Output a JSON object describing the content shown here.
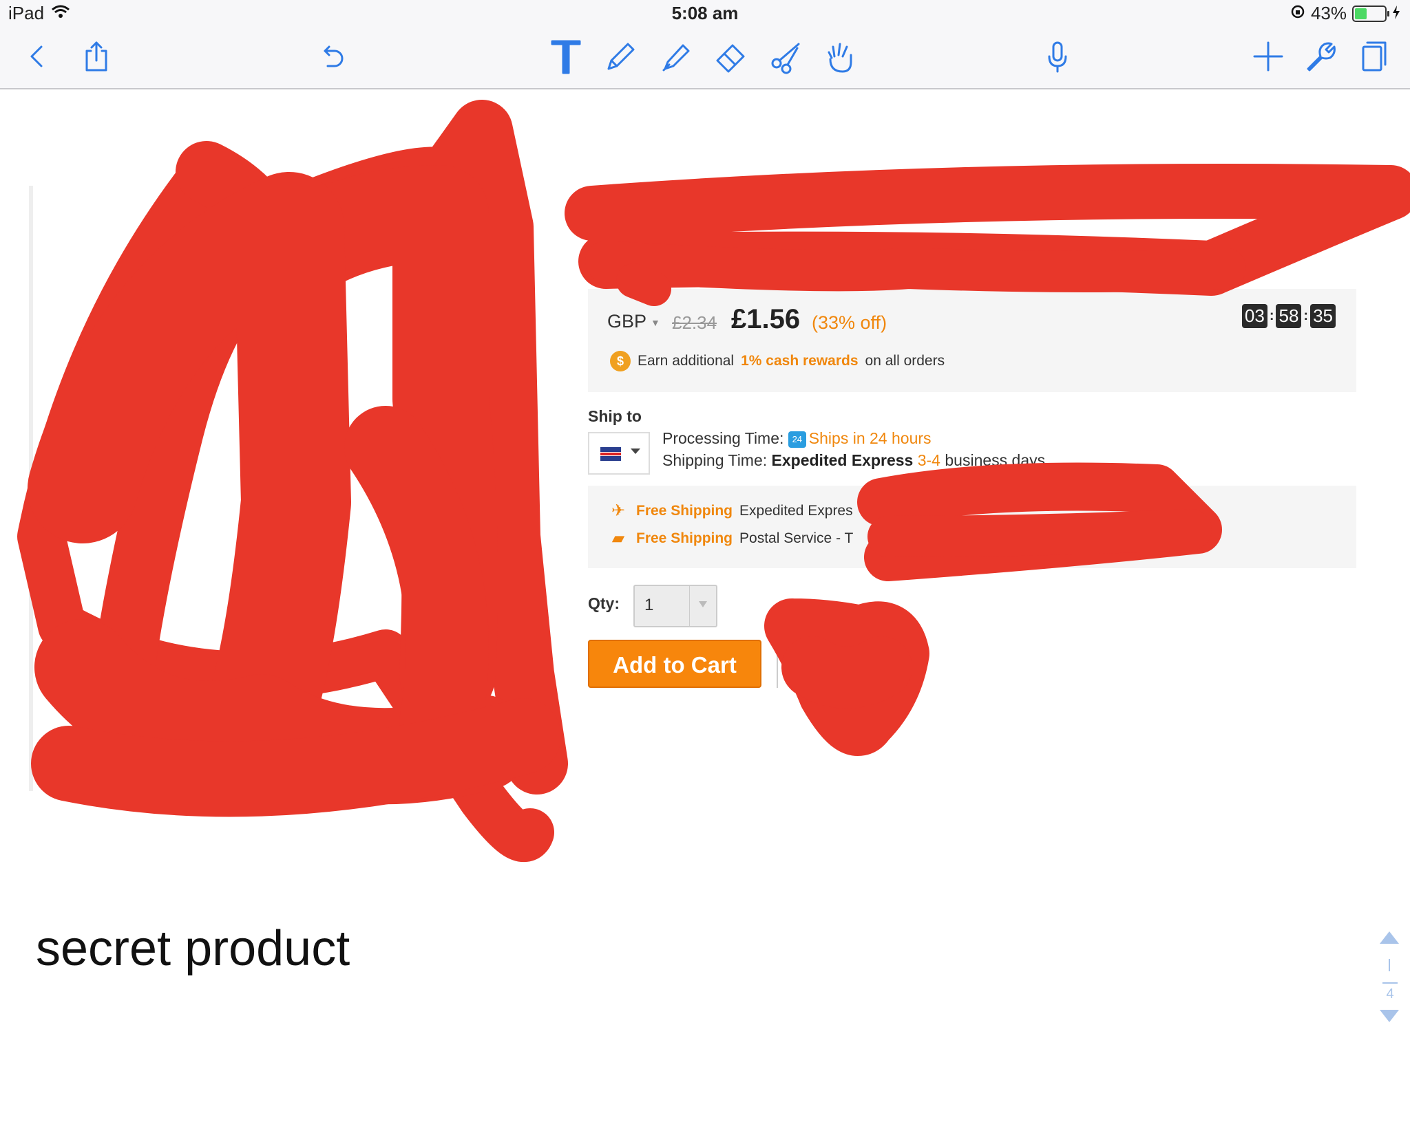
{
  "status_bar": {
    "device": "iPad",
    "time": "5:08 am",
    "battery": "43%",
    "battery_level": 0.43
  },
  "toolbar": {
    "icons": [
      "back-icon",
      "share-icon",
      "undo-icon",
      "text-tool-icon",
      "pen-icon",
      "highlighter-icon",
      "eraser-icon",
      "scissors-icon",
      "hand-icon",
      "microphone-icon",
      "add-icon",
      "wrench-icon",
      "pages-icon"
    ],
    "accent": "#2f7be6"
  },
  "product": {
    "currency": "GBP",
    "old_price": "£2.34",
    "new_price": "£1.56",
    "discount": "(33% off)",
    "countdown": [
      "03",
      "58",
      "35"
    ],
    "rewards_prefix": "Earn additional",
    "rewards_highlight": "1% cash rewards",
    "rewards_suffix": "on all orders",
    "ship_to_label": "Ship to",
    "processing_label": "Processing Time:",
    "processing_value": "Ships in 24 hours",
    "shipping_label": "Shipping Time:",
    "shipping_method": "Expedited Express",
    "shipping_days": "3-4",
    "shipping_suffix": "business days",
    "free_shipping_1": "Free Shipping",
    "free_shipping_1_method": "Expedited Expres",
    "free_shipping_2": "Free Shipping",
    "free_shipping_2_method": "Postal Service - T",
    "qty_label": "Qty:",
    "qty_value": "1",
    "add_to_cart": "Add to Cart",
    "accent": "#f0870d"
  },
  "caption": "secret product",
  "pager": {
    "current": "1",
    "total": "4"
  },
  "redaction_color": "#e8372a"
}
